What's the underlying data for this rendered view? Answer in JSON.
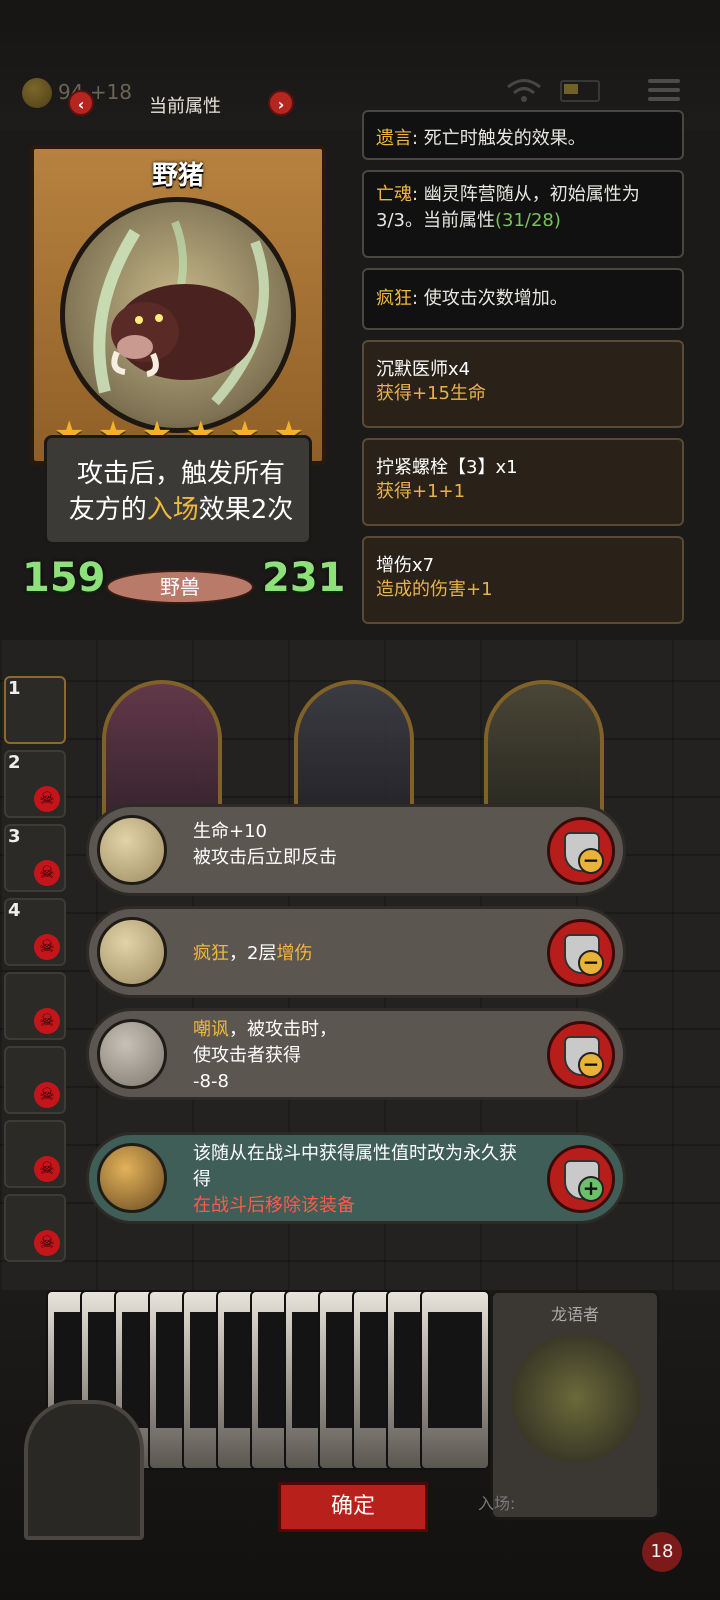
{
  "top_bar": {
    "gold": "94",
    "gold_plus": "+18",
    "panel_title": "当前属性"
  },
  "card": {
    "name": "野猪",
    "stars": 6,
    "desc_pre": "攻击后，触发所有",
    "desc_mid_a": "友方的",
    "desc_keyword": "入场",
    "desc_mid_b": "效果2次",
    "attack": "159",
    "health": "231",
    "tribe": "野兽"
  },
  "keywords": [
    {
      "key": "遗言",
      "text": ": 死亡时触发的效果。"
    },
    {
      "key": "亡魂",
      "text": ": 幽灵阵营随从，初始属性为3/3。当前属性",
      "value": "(31/28)"
    },
    {
      "key": "疯狂",
      "text": ": 使攻击次数增加。"
    }
  ],
  "buffs": [
    {
      "title": "沉默医师x4",
      "effect": "获得+15生命"
    },
    {
      "title": "拧紧螺栓【3】x1",
      "effect": "获得+1+1"
    },
    {
      "title": "增伤x7",
      "effect": "造成的伤害+1"
    }
  ],
  "roster": [
    "1",
    "2",
    "3",
    "4",
    "",
    "",
    "",
    ""
  ],
  "equipment": [
    {
      "line1": "生命+10",
      "line2": "被攻击后立即反击",
      "button": "−"
    },
    {
      "key1": "疯狂",
      "mid": "，2层",
      "key2": "增伤",
      "button": "−"
    },
    {
      "key1": "嘲讽",
      "line1": "，被攻击时，",
      "line2": "使攻击者获得",
      "line3": "-8-8",
      "button": "−"
    },
    {
      "line1": "该随从在战斗中获得属性值时改为永久获得",
      "warn": "在战斗后移除该装备",
      "button": "+"
    }
  ],
  "hand": {
    "featured_name": "龙语者",
    "entry_label": "入场:"
  },
  "confirm_label": "确定",
  "level": "18",
  "colors": {
    "accent_gold": "#f0b83a",
    "button_red": "#b8201c",
    "stat_green": "#8ee07a"
  }
}
